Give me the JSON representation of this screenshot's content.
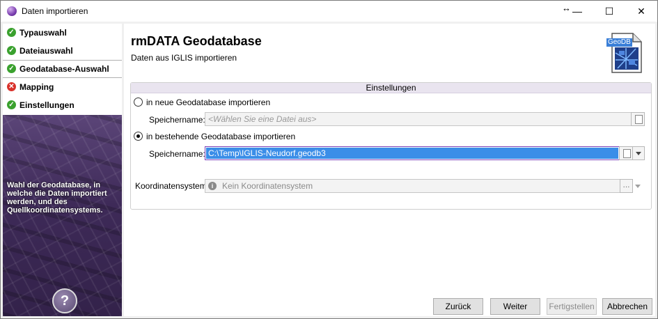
{
  "window": {
    "title": "Daten importieren"
  },
  "titlebar": {
    "resize_glyph": "↔",
    "minimize": "—",
    "maximize": "☐",
    "close": "✕"
  },
  "steps": [
    {
      "label": "Typauswahl",
      "status": "ok"
    },
    {
      "label": "Dateiauswahl",
      "status": "ok"
    },
    {
      "label": "Geodatabase-Auswahl",
      "status": "ok",
      "active": true
    },
    {
      "label": "Mapping",
      "status": "error"
    },
    {
      "label": "Einstellungen",
      "status": "ok"
    }
  ],
  "sidebar": {
    "description": "Wahl der Geodatabase, in welche die Daten importiert werden, und des Quellkoordinatensystems.",
    "help": "?"
  },
  "header": {
    "title": "rmDATA Geodatabase",
    "subtitle": "Daten aus IGLIS importieren",
    "icon_label": "GeoDB"
  },
  "settings": {
    "group_title": "Einstellungen",
    "option_new": "in neue Geodatabase importieren",
    "option_existing": "in bestehende Geodatabase importieren",
    "selected_option": "existing",
    "save_name_label": "Speichername:",
    "new_save_placeholder": "<Wählen Sie eine Datei aus>",
    "existing_save_value": "C:\\Temp\\IGLIS-Neudorf.geodb3",
    "coord_label": "Koordinatensystem",
    "coord_value": "Kein Koordinatensystem",
    "coord_dots": "..."
  },
  "buttons": {
    "back": "Zurück",
    "next": "Weiter",
    "finish": "Fertigstellen",
    "cancel": "Abbrechen"
  },
  "icons": {
    "ok": "check-circle-icon",
    "error": "error-circle-icon"
  },
  "colors": {
    "ok": "#3aa12e",
    "error": "#d9312a",
    "selection": "#3b8ee8",
    "focus": "#7a40b8"
  }
}
